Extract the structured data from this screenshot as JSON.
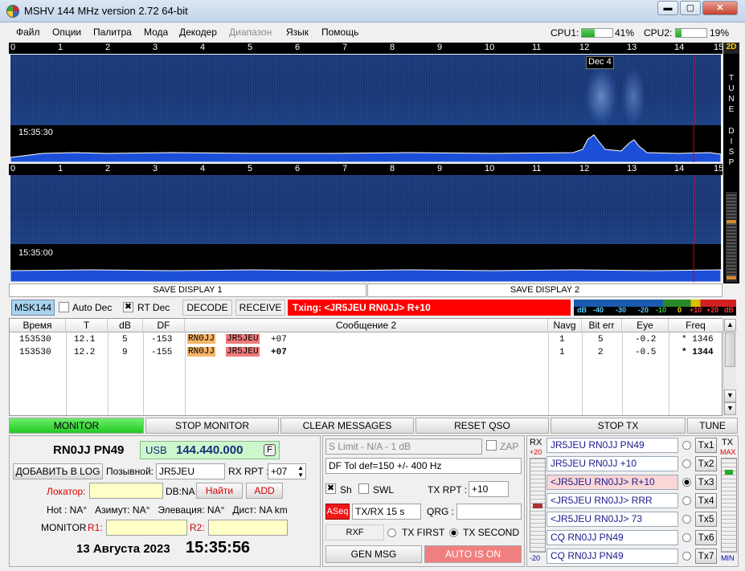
{
  "window": {
    "title": "MSHV 144 MHz version 2.72 64-bit",
    "min": "▬",
    "max": "▢",
    "close": "✕"
  },
  "menu": {
    "items": [
      "Файл",
      "Опции",
      "Палитра",
      "Мода",
      "Декодер",
      "Диапазон",
      "Язык",
      "Помощь"
    ]
  },
  "cpu": {
    "cpu1_label": "CPU1:",
    "cpu1_value": "41%",
    "cpu1_fill": 0.41,
    "cpu2_label": "CPU2:",
    "cpu2_value": "19%",
    "cpu2_fill": 0.19
  },
  "scale": {
    "ticks": [
      "0",
      "1",
      "2",
      "3",
      "4",
      "5",
      "6",
      "7",
      "8",
      "9",
      "10",
      "11",
      "12",
      "13",
      "14",
      "15"
    ]
  },
  "waterfall1": {
    "time": "15:35:30",
    "marker_label": "Dec 4"
  },
  "waterfall2": {
    "time": "15:35:00"
  },
  "side": {
    "mode": "2D",
    "tune_label": "TUNE",
    "disp_label": "DISP"
  },
  "save": {
    "d1": "SAVE DISPLAY 1",
    "d2": "SAVE DISPLAY 2"
  },
  "status": {
    "mode": "MSK144",
    "auto_dec": "Auto Dec",
    "rt_dec": "RT Dec",
    "decode": "DECODE",
    "receive": "RECEIVE",
    "txing": "Txing: <JR5JEU RN0JJ> R+10"
  },
  "meter": {
    "labels": [
      "dB",
      "-40",
      "-30",
      "-20",
      "-10",
      "0",
      "+10",
      "+20",
      "dB"
    ]
  },
  "table": {
    "headers": [
      "Время",
      "T",
      "dB",
      "DF",
      "Сообщение 2",
      "Navg",
      "Bit err",
      "Eye",
      "Freq"
    ],
    "rows": [
      {
        "time": "153530",
        "t": "12.1",
        "db": "5",
        "df": "-153",
        "call1": "RN0JJ",
        "call2": "JR5JEU",
        "rpt": "+07",
        "navg": "1",
        "biterr": "5",
        "eye": "-0.2",
        "freq": "* 1346"
      },
      {
        "time": "153530",
        "t": "12.2",
        "db": "9",
        "df": "-155",
        "call1": "RN0JJ",
        "call2": "JR5JEU",
        "rpt": "+07",
        "navg": "1",
        "biterr": "2",
        "eye": "-0.5",
        "freq": "* 1344"
      }
    ]
  },
  "buttons": {
    "monitor": "MONITOR",
    "stop_monitor": "STOP MONITOR",
    "clear_messages": "CLEAR MESSAGES",
    "reset_qso": "RESET QSO",
    "stop_tx": "STOP TX",
    "tune": "TUNE"
  },
  "station": {
    "my_call": "RN0JJ PN49",
    "usb_label": "USB",
    "freq": "144.440.000",
    "f_btn": "F",
    "add_log": "ДОБАВИТЬ В LOG",
    "call_label": "Позывной:",
    "call_value": "JR5JEU",
    "rxrpt_label": "RX RPT :",
    "rxrpt_value": "+07",
    "locator_label": "Локатор:",
    "locator_value": "",
    "db_label": "DB:NA",
    "find": "Найти",
    "add": "ADD",
    "info": "Hot : NA°   Азимут: NA°   Элевация: NA°   Дист: NA km",
    "monitor_label": "MONITOR",
    "r1": "R1:",
    "r2": "R2:",
    "date": "13 Августа 2023",
    "time": "15:35:56"
  },
  "controls": {
    "slimit": "S Limit - N/A - 1  dB",
    "zap": "ZAP",
    "dftol": "DF Tol def=150 +/-  400  Hz",
    "sh": "Sh",
    "swl": "SWL",
    "txrpt_label": "TX RPT :",
    "txrpt_value": "+10",
    "aseq": "ASeq",
    "txrx": "TX/RX 15  s",
    "qrg_label": "QRG :",
    "qrg_value": "",
    "rxf": "RXF",
    "tx_first": "TX FIRST",
    "tx_second": "TX SECOND",
    "gen_msg": "GEN MSG",
    "auto_is_on": "AUTO IS ON"
  },
  "rxpanel": {
    "rx": "RX",
    "plus20": "+20",
    "minus20": "-20",
    "tx": "TX",
    "max": "MAX",
    "min": "MIN"
  },
  "txmsgs": [
    {
      "text": "JR5JEU RN0JJ PN49",
      "btn": "Tx1"
    },
    {
      "text": "JR5JEU RN0JJ +10",
      "btn": "Tx2"
    },
    {
      "text": "<JR5JEU RN0JJ> R+10",
      "btn": "Tx3"
    },
    {
      "text": "<JR5JEU RN0JJ> RRR",
      "btn": "Tx4"
    },
    {
      "text": "<JR5JEU RN0JJ> 73",
      "btn": "Tx5"
    },
    {
      "text": "CQ RN0JJ PN49",
      "btn": "Tx6"
    },
    {
      "text": "CQ  RN0JJ PN49",
      "btn": "Tx7"
    }
  ]
}
